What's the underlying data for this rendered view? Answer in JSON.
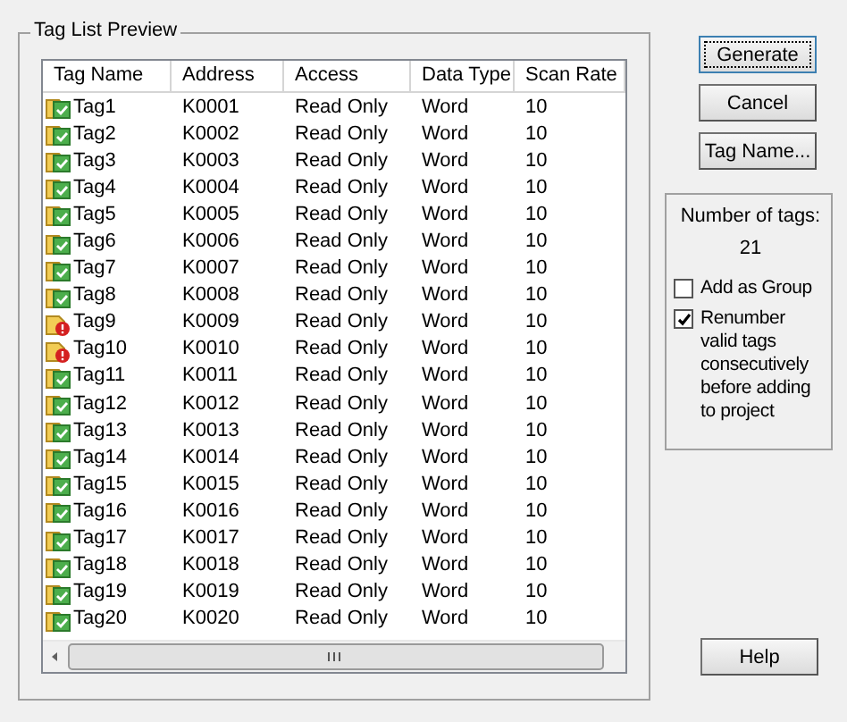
{
  "group_title": "Tag List Preview",
  "table": {
    "columns": [
      "Tag Name",
      "Address",
      "Access",
      "Data Type",
      "Scan Rate"
    ],
    "rows": [
      {
        "kind": "valid",
        "cells": [
          "Tag1",
          "K0001",
          "Read Only",
          "Word",
          "10"
        ]
      },
      {
        "kind": "valid",
        "cells": [
          "Tag2",
          "K0002",
          "Read Only",
          "Word",
          "10"
        ]
      },
      {
        "kind": "valid",
        "cells": [
          "Tag3",
          "K0003",
          "Read Only",
          "Word",
          "10"
        ]
      },
      {
        "kind": "valid",
        "cells": [
          "Tag4",
          "K0004",
          "Read Only",
          "Word",
          "10"
        ]
      },
      {
        "kind": "valid",
        "cells": [
          "Tag5",
          "K0005",
          "Read Only",
          "Word",
          "10"
        ]
      },
      {
        "kind": "valid",
        "cells": [
          "Tag6",
          "K0006",
          "Read Only",
          "Word",
          "10"
        ]
      },
      {
        "kind": "valid",
        "cells": [
          "Tag7",
          "K0007",
          "Read Only",
          "Word",
          "10"
        ]
      },
      {
        "kind": "valid",
        "cells": [
          "Tag8",
          "K0008",
          "Read Only",
          "Word",
          "10"
        ]
      },
      {
        "kind": "error",
        "cells": [
          "Tag9",
          "K0009",
          "Read Only",
          "Word",
          "10"
        ]
      },
      {
        "kind": "error",
        "cells": [
          "Tag10",
          "K0010",
          "Read Only",
          "Word",
          "10"
        ]
      },
      {
        "kind": "valid",
        "cells": [
          "Tag11",
          "K0011",
          "Read Only",
          "Word",
          "10"
        ]
      },
      {
        "kind": "valid",
        "cells": [
          "Tag12",
          "K0012",
          "Read Only",
          "Word",
          "10"
        ]
      },
      {
        "kind": "valid",
        "cells": [
          "Tag13",
          "K0013",
          "Read Only",
          "Word",
          "10"
        ]
      },
      {
        "kind": "valid",
        "cells": [
          "Tag14",
          "K0014",
          "Read Only",
          "Word",
          "10"
        ]
      },
      {
        "kind": "valid",
        "cells": [
          "Tag15",
          "K0015",
          "Read Only",
          "Word",
          "10"
        ]
      },
      {
        "kind": "valid",
        "cells": [
          "Tag16",
          "K0016",
          "Read Only",
          "Word",
          "10"
        ]
      },
      {
        "kind": "valid",
        "cells": [
          "Tag17",
          "K0017",
          "Read Only",
          "Word",
          "10"
        ]
      },
      {
        "kind": "valid",
        "cells": [
          "Tag18",
          "K0018",
          "Read Only",
          "Word",
          "10"
        ]
      },
      {
        "kind": "valid",
        "cells": [
          "Tag19",
          "K0019",
          "Read Only",
          "Word",
          "10"
        ]
      },
      {
        "kind": "valid",
        "cells": [
          "Tag20",
          "K0020",
          "Read Only",
          "Word",
          "10"
        ]
      }
    ]
  },
  "buttons_top": [
    {
      "label": "Generate",
      "focused": true
    },
    {
      "label": "Cancel",
      "focused": false
    },
    {
      "label": "Tag Name...",
      "focused": false
    }
  ],
  "count_label": "Number of tags:",
  "count_value": "21",
  "options": [
    {
      "label": "Add as Group",
      "checked": false
    },
    {
      "label": "Renumber valid tags consecutively before adding to project",
      "checked": true
    }
  ],
  "help_button": {
    "label": "Help",
    "focused": false
  }
}
